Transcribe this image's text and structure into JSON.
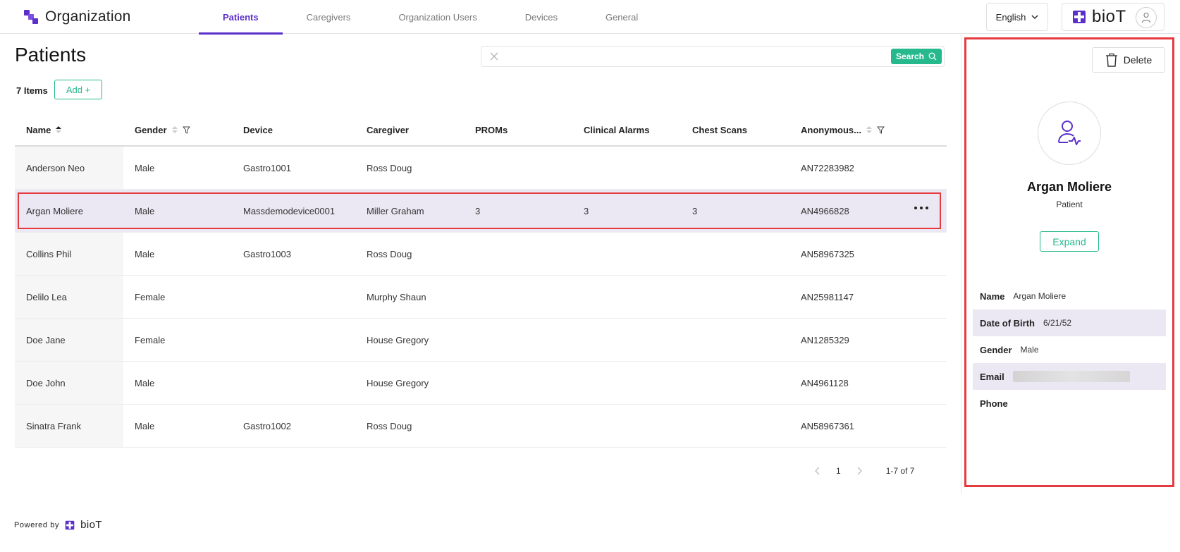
{
  "header": {
    "title": "Organization",
    "tabs": [
      {
        "label": "Patients",
        "active": true
      },
      {
        "label": "Caregivers",
        "active": false
      },
      {
        "label": "Organization Users",
        "active": false
      },
      {
        "label": "Devices",
        "active": false
      },
      {
        "label": "General",
        "active": false
      }
    ],
    "language": "English",
    "brand": "bioT"
  },
  "main": {
    "title": "Patients",
    "search": {
      "value": "",
      "placeholder": "",
      "button_label": "Search"
    },
    "items_count": "7 Items",
    "add_label": "Add +",
    "columns": [
      "Name",
      "Gender",
      "Device",
      "Caregiver",
      "PROMs",
      "Clinical Alarms",
      "Chest Scans",
      "Anonymous..."
    ],
    "rows": [
      {
        "name": "Anderson Neo",
        "gender": "Male",
        "device": "Gastro1001",
        "caregiver": "Ross Doug",
        "proms": "",
        "alarms": "",
        "scans": "",
        "anon": "AN72283982"
      },
      {
        "name": "Argan Moliere",
        "gender": "Male",
        "device": "Massdemodevice0001",
        "caregiver": "Miller Graham",
        "proms": "3",
        "alarms": "3",
        "scans": "3",
        "anon": "AN4966828"
      },
      {
        "name": "Collins Phil",
        "gender": "Male",
        "device": "Gastro1003",
        "caregiver": "Ross Doug",
        "proms": "",
        "alarms": "",
        "scans": "",
        "anon": "AN58967325"
      },
      {
        "name": "Delilo Lea",
        "gender": "Female",
        "device": "",
        "caregiver": "Murphy Shaun",
        "proms": "",
        "alarms": "",
        "scans": "",
        "anon": "AN25981147"
      },
      {
        "name": "Doe Jane",
        "gender": "Female",
        "device": "",
        "caregiver": "House Gregory",
        "proms": "",
        "alarms": "",
        "scans": "",
        "anon": "AN1285329"
      },
      {
        "name": "Doe John",
        "gender": "Male",
        "device": "",
        "caregiver": "House Gregory",
        "proms": "",
        "alarms": "",
        "scans": "",
        "anon": "AN4961128"
      },
      {
        "name": "Sinatra Frank",
        "gender": "Male",
        "device": "Gastro1002",
        "caregiver": "Ross Doug",
        "proms": "",
        "alarms": "",
        "scans": "",
        "anon": "AN58967361"
      }
    ],
    "selected_row": 1,
    "pagination": {
      "page": "1",
      "range": "1-7 of 7"
    }
  },
  "footer": {
    "powered_by": "Powered by",
    "brand": "bioT"
  },
  "side_panel": {
    "delete_label": "Delete",
    "name": "Argan Moliere",
    "role": "Patient",
    "expand_label": "Expand",
    "details": [
      {
        "label": "Name",
        "value": "Argan Moliere"
      },
      {
        "label": "Date of Birth",
        "value": "6/21/52"
      },
      {
        "label": "Gender",
        "value": "Male"
      },
      {
        "label": "Email",
        "value": ""
      },
      {
        "label": "Phone",
        "value": ""
      }
    ]
  },
  "colors": {
    "accent": "#5b2fc9",
    "primary_green": "#25b98d",
    "highlight_red": "#e53a3f",
    "selected_row": "#ebe8f3"
  },
  "icons": [
    "organization-logo",
    "chevron-down-icon",
    "user-icon",
    "clear-icon",
    "search-icon",
    "sort-icon",
    "filter-icon",
    "more-icon",
    "trash-icon",
    "patient-icon",
    "prev-icon",
    "next-icon"
  ]
}
